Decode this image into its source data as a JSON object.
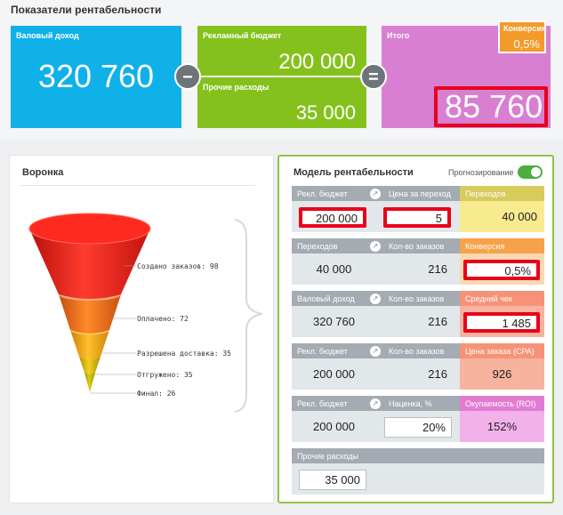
{
  "header": {
    "title": "Показатели рентабельности"
  },
  "cards": {
    "gross_income": {
      "label": "Валовый доход",
      "value": "320 760"
    },
    "ad_budget": {
      "label": "Рекламный бюджет",
      "value": "200 000"
    },
    "other_costs": {
      "label": "Прочие расходы",
      "value": "35 000"
    },
    "total": {
      "label": "Итого",
      "value": "85 760"
    },
    "conversion": {
      "label": "Конверсия",
      "value": "0,5%"
    },
    "minus": "−",
    "equals": "="
  },
  "funnel": {
    "title": "Воронка",
    "stages": [
      {
        "label": "Создано заказов: 98",
        "color": "#e8211f"
      },
      {
        "label": "Оплачено: 72",
        "color": "#ee6a17"
      },
      {
        "label": "Разрешена доставка: 35",
        "color": "#f0a012"
      },
      {
        "label": "Отгружено: 35",
        "color": "#e1b40e"
      },
      {
        "label": "Финал: 26",
        "color": "#c9b308"
      }
    ]
  },
  "model": {
    "title": "Модель рентабельности",
    "forecast_label": "Прогнозирование",
    "forecast_on": true,
    "rows": [
      {
        "c1": {
          "head": "Рекл. бюджет",
          "value": "200 000"
        },
        "c2": {
          "head": "Цена за переход",
          "value": "5"
        },
        "c3": {
          "head": "Переходов",
          "value": "40 000"
        }
      },
      {
        "c1": {
          "head": "Переходов",
          "value": "40 000"
        },
        "c2": {
          "head": "Кол-во заказов",
          "value": "216"
        },
        "c3": {
          "head": "Конверсия",
          "value": "0,5%"
        }
      },
      {
        "c1": {
          "head": "Валовый доход",
          "value": "320 760"
        },
        "c2": {
          "head": "Кол-во заказов",
          "value": "216"
        },
        "c3": {
          "head": "Средний чек",
          "value": "1 485"
        }
      },
      {
        "c1": {
          "head": "Рекл. бюджет",
          "value": "200 000"
        },
        "c2": {
          "head": "Кол-во заказов",
          "value": "216"
        },
        "c3": {
          "head": "Цена заказа (CPA)",
          "value": "926"
        }
      },
      {
        "c1": {
          "head": "Рекл. бюджет",
          "value": "200 000"
        },
        "c2": {
          "head": "Наценка, %",
          "value": "20%"
        },
        "c3": {
          "head": "Окупаемость (ROI)",
          "value": "152%"
        }
      }
    ],
    "other_costs": {
      "head": "Прочие расходы",
      "value": "35 000"
    }
  },
  "colors": {
    "blue": "#0fb1e8",
    "green": "#85c11c",
    "pink": "#d97fd1",
    "orange": "#f39a2b",
    "highlight": "#e8001c"
  }
}
